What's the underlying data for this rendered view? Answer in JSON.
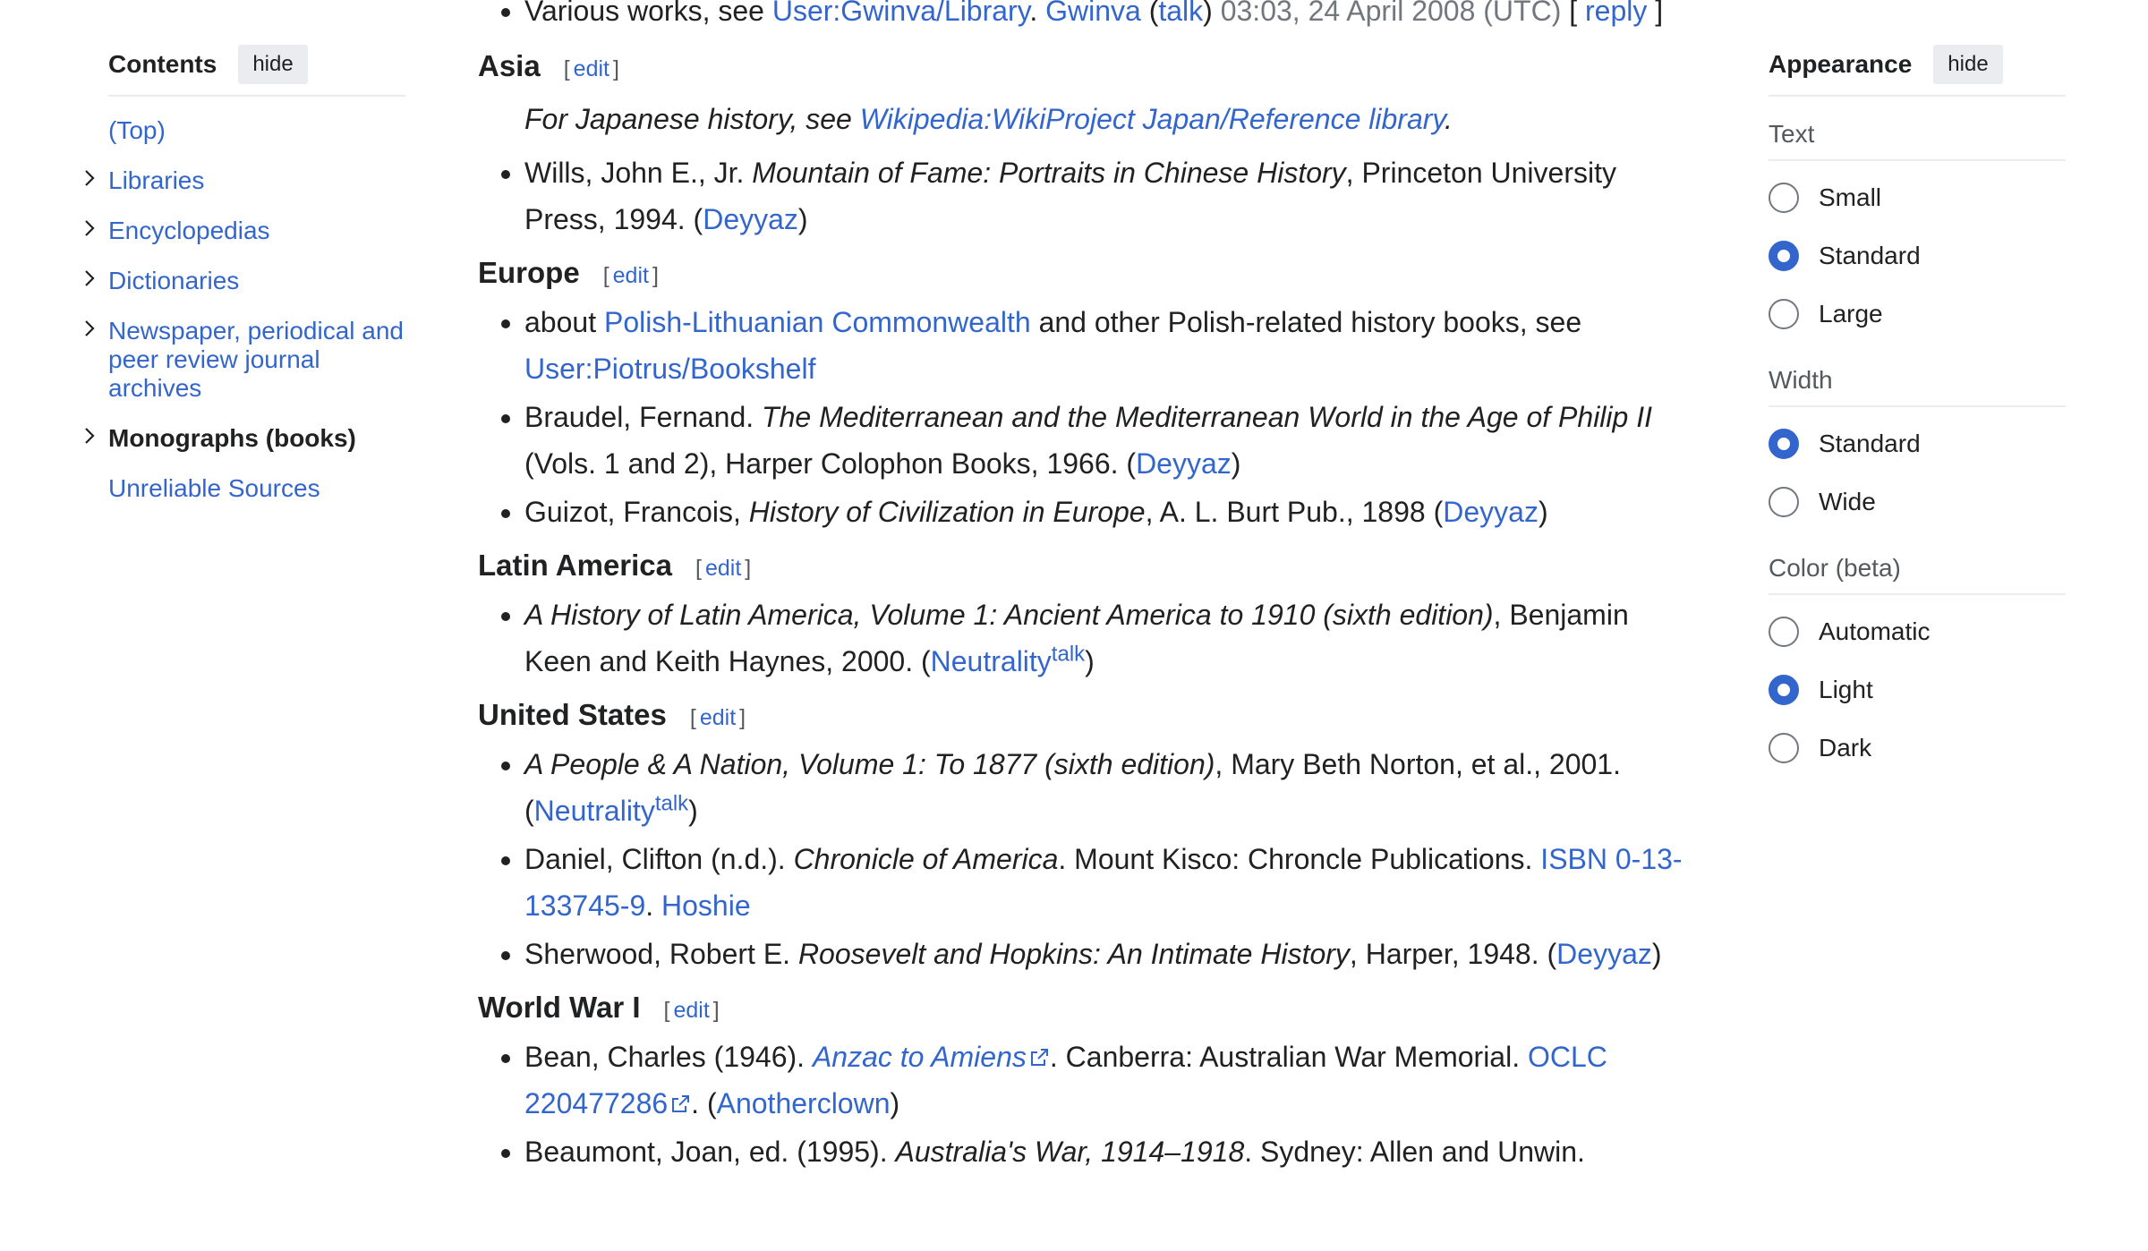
{
  "toc": {
    "title": "Contents",
    "hide_label": "hide",
    "items": [
      {
        "label": "(Top)",
        "has_chevron": false,
        "current": false
      },
      {
        "label": "Libraries",
        "has_chevron": true,
        "current": false
      },
      {
        "label": "Encyclopedias",
        "has_chevron": true,
        "current": false
      },
      {
        "label": "Dictionaries",
        "has_chevron": true,
        "current": false
      },
      {
        "label": "Newspaper, periodical and peer review journal archives",
        "has_chevron": true,
        "current": false
      },
      {
        "label": "Monographs (books)",
        "has_chevron": true,
        "current": true
      },
      {
        "label": "Unreliable Sources",
        "has_chevron": false,
        "current": false
      }
    ]
  },
  "cutoff": {
    "text_a": "Various works, see ",
    "link_library": "User:Gwinva/Library",
    "sep": ". ",
    "link_user": "Gwinva",
    "talk_open": " (",
    "link_talk": "talk",
    "talk_close": ") ",
    "timestamp": "03:03, 24 April 2008 (UTC)",
    "reply_open": " [ ",
    "reply": "reply",
    "reply_close": " ]"
  },
  "edit_label": "edit",
  "asia": {
    "heading": "Asia",
    "hatnote_prefix": "For Japanese history, see ",
    "hatnote_link": "Wikipedia:WikiProject Japan/Reference library",
    "hatnote_suffix": ".",
    "items": [
      {
        "pre": "Wills, John E., Jr. ",
        "title": "Mountain of Fame: Portraits in Chinese History",
        "post": ", Princeton University Press, 1994. (",
        "link": "Deyyaz",
        "end": ")"
      }
    ]
  },
  "europe": {
    "heading": "Europe",
    "item1": {
      "pre": "about ",
      "link1": "Polish-Lithuanian Commonwealth",
      "mid": " and other Polish-related history books, see ",
      "link2": "User:Piotrus/Bookshelf"
    },
    "item2": {
      "pre": "Braudel, Fernand. ",
      "title": "The Mediterranean and the Mediterranean World in the Age of Philip II",
      "post": " (Vols. 1 and 2), Harper Colophon Books, 1966. (",
      "link": "Deyyaz",
      "end": ")"
    },
    "item3": {
      "pre": "Guizot, Francois, ",
      "title": "History of Civilization in Europe",
      "post": ", A. L. Burt Pub., 1898 (",
      "link": "Deyyaz",
      "end": ")"
    }
  },
  "latin_america": {
    "heading": "Latin America",
    "item1": {
      "title": "A History of Latin America, Volume 1: Ancient America to 1910 (sixth edition)",
      "post": ", Benjamin Keen and Keith Haynes, 2000. (",
      "link": "Neutrality",
      "sup": "talk",
      "end": ")"
    }
  },
  "united_states": {
    "heading": "United States",
    "item1": {
      "title": "A People & A Nation, Volume 1: To 1877 (sixth edition)",
      "post": ", Mary Beth Norton, et al., 2001. (",
      "link": "Neutrality",
      "sup": "talk",
      "end": ")"
    },
    "item2": {
      "pre": "Daniel, Clifton (n.d.). ",
      "title": "Chronicle of America",
      "post": ". Mount Kisco: Chroncle Publications. ",
      "isbn": "ISBN 0-13-133745-9",
      "sep": ". ",
      "link": "Hoshie"
    },
    "item3": {
      "pre": "Sherwood, Robert E. ",
      "title": "Roosevelt and Hopkins: An Intimate History",
      "post": ", Harper, 1948. (",
      "link": "Deyyaz",
      "end": ")"
    }
  },
  "ww1": {
    "heading": "World War I",
    "item1": {
      "pre": "Bean, Charles (1946). ",
      "title": "Anzac to Amiens",
      "post": ". Canberra: Australian War Memorial. ",
      "oclc": "OCLC 220477286",
      "mid": ". (",
      "link": "Anotherclown",
      "end": ")"
    },
    "item2": {
      "pre": "Beaumont, Joan, ed. (1995). ",
      "title": "Australia's War, 1914–1918",
      "post": ". Sydney: Allen and Unwin."
    }
  },
  "appearance": {
    "title": "Appearance",
    "hide_label": "hide",
    "groups": [
      {
        "title": "Text",
        "options": [
          {
            "label": "Small",
            "selected": false
          },
          {
            "label": "Standard",
            "selected": true
          },
          {
            "label": "Large",
            "selected": false
          }
        ]
      },
      {
        "title": "Width",
        "options": [
          {
            "label": "Standard",
            "selected": true
          },
          {
            "label": "Wide",
            "selected": false
          }
        ]
      },
      {
        "title": "Color (beta)",
        "options": [
          {
            "label": "Automatic",
            "selected": false
          },
          {
            "label": "Light",
            "selected": true
          },
          {
            "label": "Dark",
            "selected": false
          }
        ]
      }
    ]
  },
  "colors": {
    "link": "#3366cc",
    "text": "#202122",
    "radio_selected": "#3366cc",
    "button_bg": "#eaecf0"
  }
}
